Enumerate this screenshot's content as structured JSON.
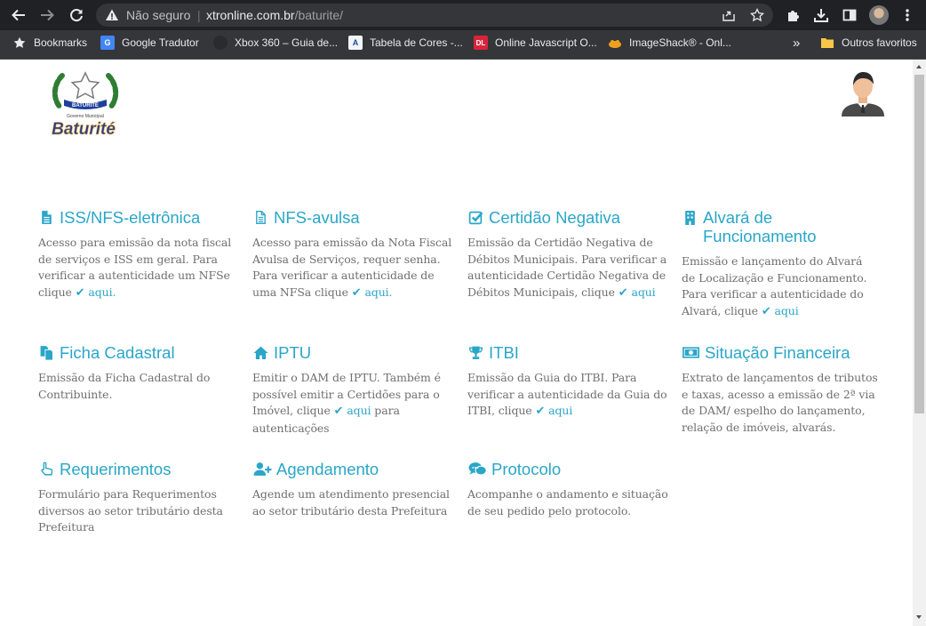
{
  "browser": {
    "security_label": "Não seguro",
    "url_host": "xtronline.com.br",
    "url_path": "/baturite/",
    "bookmarks": [
      {
        "label": "Bookmarks",
        "icon": "star-icon"
      },
      {
        "label": "Google Tradutor",
        "icon": "google-translate-icon"
      },
      {
        "label": "Xbox 360 – Guia de...",
        "icon": "xbox-icon"
      },
      {
        "label": "Tabela de Cores -...",
        "icon": "tabela-cores-icon"
      },
      {
        "label": "Online Javascript O...",
        "icon": "dl-icon"
      },
      {
        "label": "ImageShack® - Onl...",
        "icon": "imageshack-icon"
      }
    ],
    "overflow_label": "»",
    "other_bookmarks": "Outros favoritos"
  },
  "logo": {
    "banner_text": "BATURITÉ",
    "subtitle": "Governo Municipal",
    "name": "Baturité"
  },
  "cards": [
    {
      "id": "iss",
      "icon": "file-text-icon",
      "title": "ISS/NFS-eletrônica",
      "desc": "Acesso para emissão da nota fiscal de serviços e ISS em geral. Para verificar a autenticidade um NFSe clique",
      "link": "aqui.",
      "after": ""
    },
    {
      "id": "nfs-avulsa",
      "icon": "file-outline-icon",
      "title": "NFS-avulsa",
      "desc": "Acesso para emissão da Nota Fiscal Avulsa de Serviços, requer senha. Para verificar a autenticidade de uma NFSa clique",
      "link": "aqui.",
      "after": ""
    },
    {
      "id": "certidao",
      "icon": "check-square-icon",
      "title": "Certidão Negativa",
      "desc": "Emissão da Certidão Negativa de Débitos Municipais. Para verificar a autenticidade Certidão Negativa de Débitos Municipais, clique",
      "link": "aqui",
      "after": ""
    },
    {
      "id": "alvara",
      "icon": "building-icon",
      "title": "Alvará de Funcionamento",
      "desc": "Emissão e lançamento do Alvará de Localização e Funcionamento. Para verificar a autenticidade do Alvará, clique",
      "link": "aqui",
      "after": ""
    },
    {
      "id": "ficha",
      "icon": "files-icon",
      "title": "Ficha Cadastral",
      "desc": "Emissão da Ficha Cadastral do Contribuinte.",
      "link": "",
      "after": ""
    },
    {
      "id": "iptu",
      "icon": "home-icon",
      "title": "IPTU",
      "desc": "Emitir o DAM de IPTU. Também é possível emitir a Certidões para o Imóvel, clique",
      "link": "aqui",
      "after": " para autenticações"
    },
    {
      "id": "itbi",
      "icon": "trophy-icon",
      "title": "ITBI",
      "desc": "Emissão da Guia do ITBI. Para verificar a autenticidade da Guia do ITBI, clique",
      "link": "aqui",
      "after": ""
    },
    {
      "id": "situacao",
      "icon": "money-icon",
      "title": "Situação Financeira",
      "desc": "Extrato de lançamentos de tributos e taxas, acesso a emissão de 2ª via de DAM/ espelho do lançamento, relação de imóveis, alvarás.",
      "link": "",
      "after": ""
    },
    {
      "id": "requerimentos",
      "icon": "hand-pointer-icon",
      "title": "Requerimentos",
      "desc": "Formulário para Requerimentos diversos ao setor tributário desta Prefeitura",
      "link": "",
      "after": ""
    },
    {
      "id": "agendamento",
      "icon": "user-plus-icon",
      "title": "Agendamento",
      "desc": "Agende um atendimento presencial ao setor tributário desta Prefeitura",
      "link": "",
      "after": ""
    },
    {
      "id": "protocolo",
      "icon": "comments-icon",
      "title": "Protocolo",
      "desc": "Acompanhe o andamento e situação de seu pedido pelo protocolo.",
      "link": "",
      "after": ""
    }
  ],
  "colors": {
    "accent": "#2aa6c8",
    "text": "#6f6f6f",
    "chrome_dark": "#202124",
    "chrome_bar": "#35363a"
  }
}
